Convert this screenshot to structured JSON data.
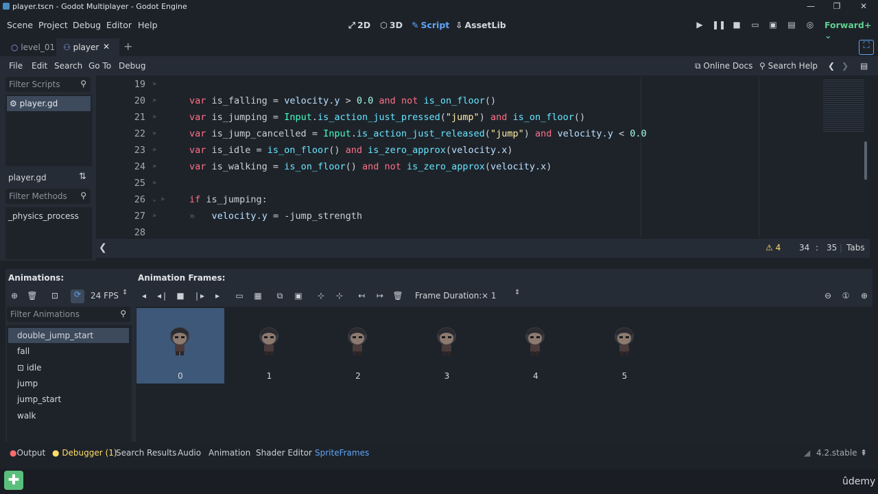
{
  "window": {
    "title": "player.tscn - Godot Multiplayer - Godot Engine",
    "controls": [
      "—",
      "❐",
      "✕"
    ]
  },
  "menubar": {
    "items": [
      "Scene",
      "Project",
      "Debug",
      "Editor",
      "Help"
    ],
    "workspaces": [
      {
        "label": "2D",
        "icon": "2d-icon"
      },
      {
        "label": "3D",
        "icon": "3d-icon"
      },
      {
        "label": "Script",
        "icon": "script-icon",
        "active": true
      },
      {
        "label": "AssetLib",
        "icon": "assetlib-icon"
      }
    ],
    "renderer": "Forward+"
  },
  "scene_tabs": [
    {
      "label": "level_01",
      "icon": "node2d-icon"
    },
    {
      "label": "player",
      "icon": "character-icon",
      "active": true
    }
  ],
  "script_toolbar": {
    "menus": [
      "File",
      "Edit",
      "Search",
      "Go To",
      "Debug"
    ],
    "online_docs": "Online Docs",
    "search_help": "Search Help"
  },
  "scripts_panel": {
    "filter_placeholder": "Filter Scripts",
    "scripts": [
      "player.gd"
    ],
    "current_script": "player.gd",
    "methods_placeholder": "Filter Methods",
    "methods": [
      "_physics_process"
    ]
  },
  "code": {
    "lines": [
      {
        "n": "19",
        "text": ""
      },
      {
        "n": "20",
        "text": "var is_falling = velocity.y > 0.0 and not is_on_floor()"
      },
      {
        "n": "21",
        "text": "var is_jumping = Input.is_action_just_pressed(\"jump\") and is_on_floor()"
      },
      {
        "n": "22",
        "text": "var is_jump_cancelled = Input.is_action_just_released(\"jump\") and velocity.y < 0.0"
      },
      {
        "n": "23",
        "text": "var is_idle = is_on_floor() and is_zero_approx(velocity.x)"
      },
      {
        "n": "24",
        "text": "var is_walking = is_on_floor() and not is_zero_approx(velocity.x)"
      },
      {
        "n": "25",
        "text": ""
      },
      {
        "n": "26",
        "text": "if is_jumping:"
      },
      {
        "n": "27",
        "text": "    velocity.y = -jump_strength"
      },
      {
        "n": "28",
        "text": ""
      }
    ]
  },
  "status": {
    "warnings": "4",
    "line": "34",
    "sep": ":",
    "col": "35",
    "indent": "Tabs"
  },
  "animations": {
    "header": "Animations:",
    "fps": "24 FPS",
    "filter_placeholder": "Filter Animations",
    "items": [
      "double_jump_start",
      "fall",
      "idle",
      "jump",
      "jump_start",
      "walk"
    ],
    "selected": "double_jump_start"
  },
  "frames": {
    "header": "Animation Frames:",
    "duration_label": "Frame Duration:",
    "duration_value": "× 1",
    "items": [
      "0",
      "1",
      "2",
      "3",
      "4",
      "5"
    ],
    "selected_index": 0
  },
  "bottom_tabs": {
    "items": [
      "Output",
      "Debugger (1)",
      "Search Results",
      "Audio",
      "Animation",
      "Shader Editor",
      "SpriteFrames"
    ],
    "active": "SpriteFrames",
    "version": "4.2.stable"
  },
  "taskbar": {
    "brand": "ûdemy"
  },
  "colors": {
    "accent": "#5fa5f5",
    "keyword": "#ff7085",
    "function": "#66e6ff",
    "class": "#42ffc2",
    "string": "#ffeda1",
    "number": "#a1ffe0",
    "warning": "#ffdd65"
  }
}
